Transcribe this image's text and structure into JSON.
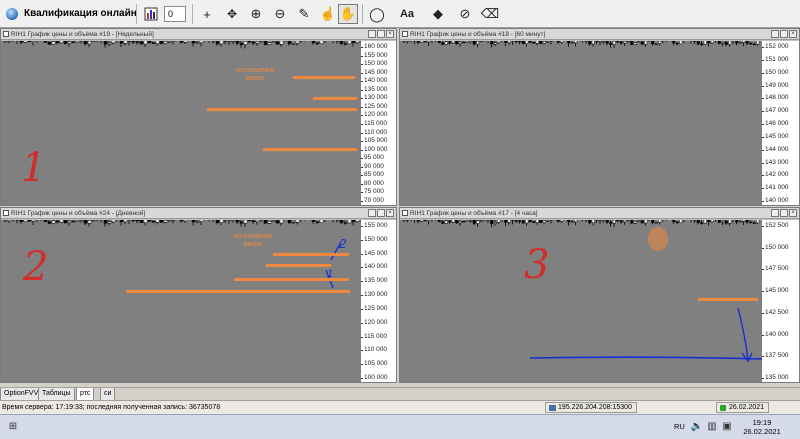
{
  "app": {
    "title": "Квалификация онлайн",
    "spin_value": "0"
  },
  "toolbar": {
    "icons": [
      "bar-chart-icon",
      "crosshair-icon",
      "move-icon",
      "zoom-in-icon",
      "zoom-out-icon",
      "pencil-icon",
      "hand-icon",
      "ellipse-icon",
      "text-icon",
      "fill-icon",
      "hide-icon",
      "eraser-icon"
    ]
  },
  "charts": [
    {
      "title": "RIH1 График цены и объёма #19 - [Недельный]",
      "number": "1",
      "annotation": "поглощение вверх",
      "axis_labels": [
        "160 000",
        "155 000",
        "150 000",
        "145 000",
        "140 000",
        "135 000",
        "130 000",
        "125 000",
        "120 000",
        "115 000",
        "110 000",
        "105 000",
        "100 000",
        "95 000",
        "90 000",
        "85 000",
        "80 000",
        "75 000",
        "70 000"
      ]
    },
    {
      "title": "RIH1 График цены и объёма #18 - [60 минут]",
      "number": "",
      "annotation": "",
      "axis_labels": [
        "152 000",
        "151 000",
        "150 000",
        "149 000",
        "148 000",
        "147 000",
        "146 000",
        "145 000",
        "144 000",
        "143 000",
        "142 000",
        "141 000",
        "140 000"
      ]
    },
    {
      "title": "RIH1 График цены и объёма #24 - [Дневной]",
      "number": "2",
      "annotation": "поглощение вверх",
      "wave_labels": [
        "2",
        "1"
      ],
      "axis_labels": [
        "155 000",
        "150 000",
        "145 000",
        "140 000",
        "135 000",
        "130 000",
        "125 000",
        "120 000",
        "115 000",
        "110 000",
        "105 000",
        "100 000"
      ]
    },
    {
      "title": "RIH1 График цены и объёма #17 - [4 часа]",
      "number": "3",
      "annotation": "",
      "axis_labels": [
        "152 500",
        "150 000",
        "147 500",
        "145 000",
        "142 500",
        "140 000",
        "137 500",
        "135 000"
      ]
    }
  ],
  "tabs": [
    "OptionFVV",
    "Таблицы",
    "ртс",
    "си"
  ],
  "active_tab": "ртс",
  "status": {
    "server_time": "Время сервера: 17:19:33; последняя полученная запись: 36735078",
    "ip": "195.226.204.208:15300",
    "date": "26.02.2021"
  },
  "taskbar": {
    "lang": "RU",
    "time": "19:19",
    "date": "26.02.2021"
  },
  "colors": {
    "level": "#f0893e",
    "handwriting_red": "#d22d2d",
    "handwriting_blue": "#1a2fd0",
    "plot_bg": "#808080"
  }
}
